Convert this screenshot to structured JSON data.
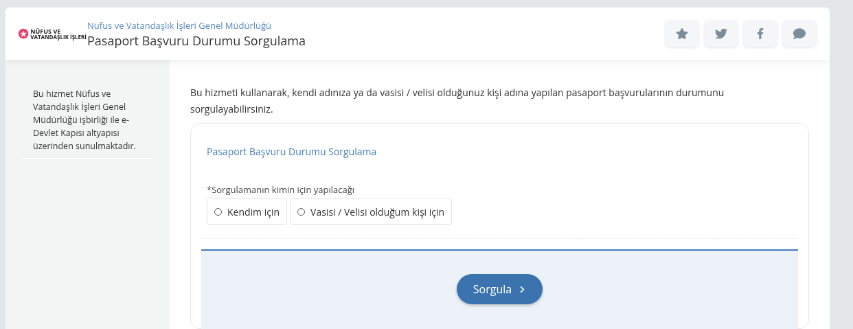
{
  "header": {
    "logo": {
      "line_1": "NÜFUS VE",
      "line_2": "VATANDAŞLIK İŞLERİ"
    },
    "agency": "Nüfus ve Vatandaşlık İşleri Genel Müdürlüğü",
    "title": "Pasaport Başvuru Durumu Sorgulama",
    "actions": [
      {
        "kind": "star"
      },
      {
        "kind": "twitter"
      },
      {
        "kind": "facebook"
      },
      {
        "kind": "comment"
      }
    ]
  },
  "sidebar": {
    "text": "Bu hizmet Nüfus ve Vatandaşlık İşleri Genel Müdürlüğü işbirliği ile e-Devlet Kapısı altyapısı üzerinden sunulmaktadır."
  },
  "intro": "Bu hizmeti kullanarak, kendi adınıza ya da vasisi / velisi olduğunuz kişi adına yapılan pasaport başvurularının durumunu sorgulayabilirsiniz.",
  "form": {
    "title": "Pasaport Başvuru Durumu Sorgulama",
    "question": "*Sorgulamanın kimin için yapılacağı",
    "options": [
      {
        "label": "Kendim için",
        "selected": false
      },
      {
        "label": "Vasisi / Velisi olduğum kişi için",
        "selected": false
      }
    ],
    "submit": "Sorgula"
  }
}
